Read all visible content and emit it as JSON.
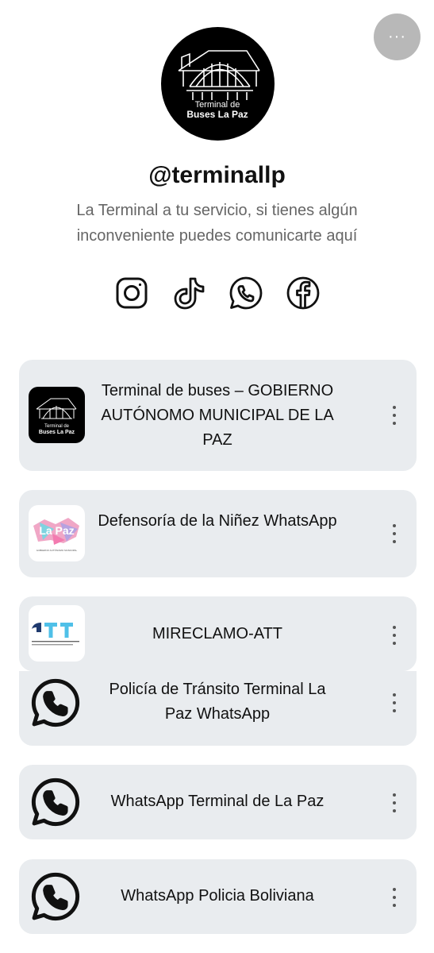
{
  "profile": {
    "handle": "@terminallp",
    "bio": "La Terminal a tu servicio, si tienes algún inconveniente puedes comunicarte aquí",
    "logo_text_line1": "Terminal de",
    "logo_text_line2": "Buses La Paz"
  },
  "header": {
    "more_label": "···"
  },
  "socials": [
    {
      "icon": "instagram-icon"
    },
    {
      "icon": "tiktok-icon"
    },
    {
      "icon": "whatsapp-icon"
    },
    {
      "icon": "facebook-icon"
    }
  ],
  "links": [
    {
      "label": "Terminal de buses – GOBIERNO AUTÓNOMO MUNICIPAL DE LA PAZ",
      "thumb": "terminal-logo",
      "thumb_text1": "Terminal de",
      "thumb_text2": "Buses La Paz"
    },
    {
      "label": "Defensoría de la Niñez WhatsApp",
      "thumb": "la-paz-logo",
      "thumb_text1": "La Paz",
      "thumb_text2": "GOBIERNO AUTÓNOMO MUNICIPAL"
    },
    {
      "label": "MIRECLAMO-ATT",
      "thumb": "att-logo",
      "thumb_text1": "ATT"
    },
    {
      "label": "Policía de Tránsito Terminal La Paz WhatsApp",
      "thumb": "whatsapp-icon"
    },
    {
      "label": "WhatsApp Terminal de La Paz",
      "thumb": "whatsapp-icon"
    },
    {
      "label": "WhatsApp Policia Boliviana",
      "thumb": "whatsapp-icon"
    }
  ],
  "colors": {
    "card_bg": "#e9ecef",
    "bio_text": "#666666",
    "more_button_bg": "#b8b8b8"
  }
}
